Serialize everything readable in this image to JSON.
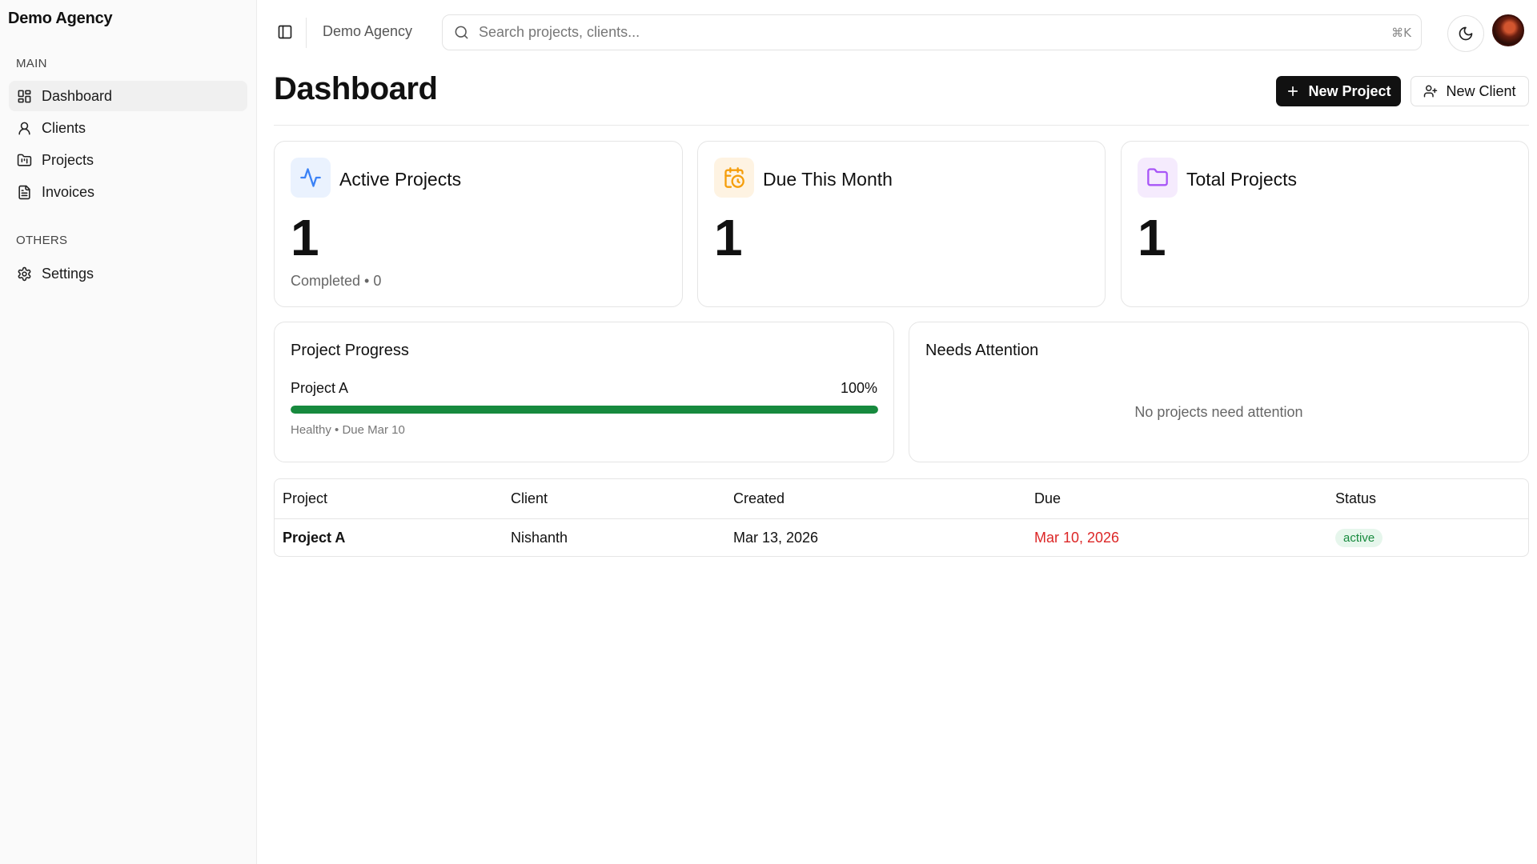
{
  "sidebar": {
    "brand": "Demo Agency",
    "sections": [
      {
        "label": "MAIN"
      },
      {
        "label": "OTHERS"
      }
    ],
    "items": [
      {
        "label": "Dashboard",
        "icon": "layout-grid-icon",
        "active": true
      },
      {
        "label": "Clients",
        "icon": "user-icon"
      },
      {
        "label": "Projects",
        "icon": "folder-kanban-icon"
      },
      {
        "label": "Invoices",
        "icon": "file-text-icon"
      },
      {
        "label": "Settings",
        "icon": "gear-icon"
      }
    ]
  },
  "topbar": {
    "breadcrumb": "Demo Agency",
    "search_placeholder": "Search projects, clients...",
    "shortcut": "⌘K"
  },
  "page": {
    "title": "Dashboard",
    "new_project_label": "New Project",
    "new_client_label": "New Client"
  },
  "stats": [
    {
      "title": "Active Projects",
      "value": "1",
      "sub": "Completed • 0",
      "icon": "activity-icon",
      "accent": "#3b82f6"
    },
    {
      "title": "Due This Month",
      "value": "1",
      "icon": "calendar-clock-icon",
      "accent": "#f59e0b"
    },
    {
      "title": "Total Projects",
      "value": "1",
      "icon": "folder-icon",
      "accent": "#a855f7"
    }
  ],
  "progress": {
    "title": "Project Progress",
    "items": [
      {
        "name": "Project A",
        "percent_label": "100%",
        "percent": 100,
        "meta": "Healthy • Due Mar 10"
      }
    ],
    "bar_color": "#178a3e"
  },
  "attention": {
    "title": "Needs Attention",
    "empty_message": "No projects need attention"
  },
  "table": {
    "headers": [
      "Project",
      "Client",
      "Created",
      "Due",
      "Status"
    ],
    "rows": [
      {
        "project": "Project A",
        "client": "Nishanth",
        "created": "Mar 13, 2026",
        "due": "Mar 10, 2026",
        "status": "active"
      }
    ],
    "overdue_color": "#dc2626"
  }
}
